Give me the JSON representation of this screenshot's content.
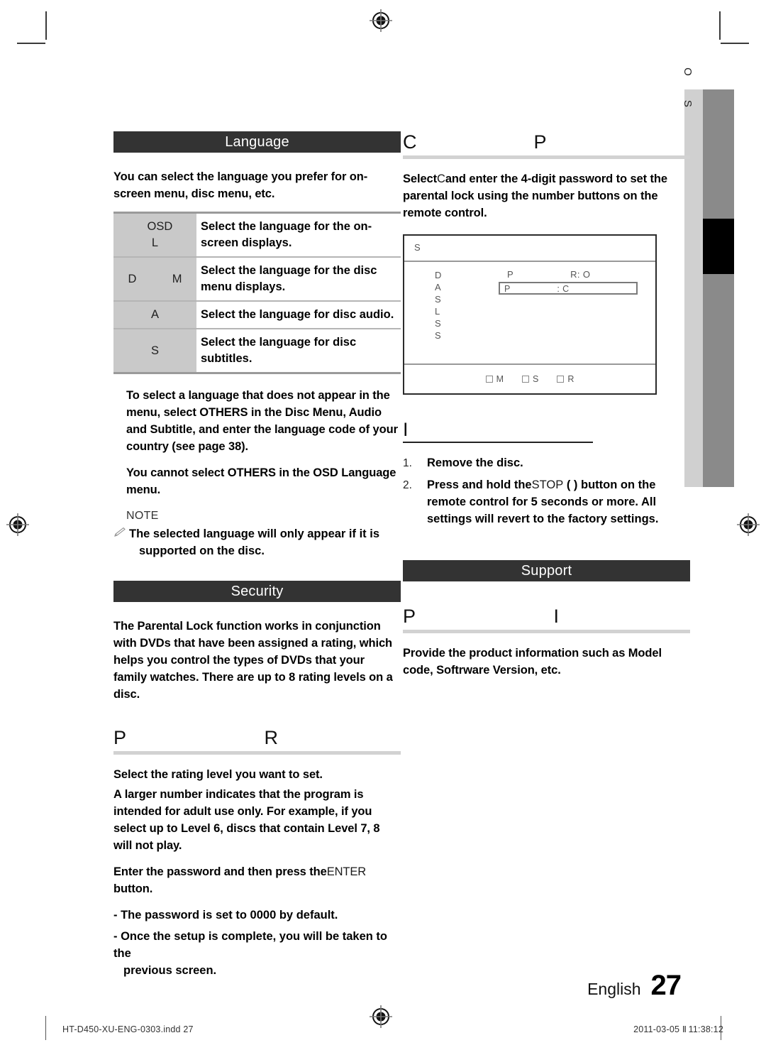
{
  "document": {
    "footer_language": "English",
    "page_number": "27",
    "print_filename": "HT-D450-XU-ENG-0303.indd   27",
    "print_date": "2011-03-05",
    "print_separator": "Ⅱ",
    "print_time": "11:38:12"
  },
  "thumb_tab": {
    "letters": "OS"
  },
  "left_column": {
    "section_header": "Language",
    "intro": "You can select the language you prefer for on-screen menu, disc menu, etc.",
    "table": {
      "rows": [
        {
          "label": "   OSD\nL",
          "description": "Select the language for the on-screen displays."
        },
        {
          "label": "D           M",
          "description": "Select the language for the disc menu displays."
        },
        {
          "label": "A",
          "description": "Select the language for disc audio."
        },
        {
          "label": "S",
          "description": "Select the language for disc subtitles."
        }
      ]
    },
    "paragraph_1": "To select a language that does not appear in the menu, select OTHERS in the Disc Menu, Audio and Subtitle, and enter the language code of your country (see page 38).",
    "paragraph_2": "You cannot select OTHERS in the OSD Language menu.",
    "note_title": "NOTE",
    "note_text": "The selected language will only appear if it is",
    "note_text_cont": "supported on the disc.",
    "security_header": "Security",
    "security_intro": "The Parental Lock function works in conjunction with DVDs that have been assigned a rating, which helps you control the types of DVDs that your family watches. There are up to 8 rating levels on a disc.",
    "parental_rating_subhead": "P                          R",
    "rating_line_1": "Select the rating level you want to set.",
    "rating_line_2": "A larger number indicates that the program is intended for adult use only. For example, if you select up to Level 6, discs that contain Level 7, 8 will not play.",
    "enter_password_pre": "Enter the password and then press the",
    "enter_password_button": "ENTER",
    "enter_password_post": " button.",
    "dash_1_pre": "- The password is set to ",
    "dash_1_value": "0000",
    "dash_1_post": " by default.",
    "dash_2": "- Once the setup is complete, you will be taken to the",
    "dash_2_cont": "previous screen."
  },
  "right_column": {
    "change_password_subhead": "C                      P",
    "change_password_pre": "Select",
    "change_password_ui": "C",
    "change_password_post": "and enter the 4-digit password to set the parental lock using the number buttons on the remote control.",
    "osd": {
      "title": "S",
      "menu_items": [
        "D",
        "A",
        "S",
        "L",
        "S",
        "S"
      ],
      "right_label": "P                    R: O",
      "field_value": "P                 : C",
      "footer_keys": [
        {
          "label": "M"
        },
        {
          "label": "S"
        },
        {
          "label": "R"
        }
      ]
    },
    "forgot_password_subhead": "I",
    "steps": [
      {
        "num": "1.",
        "text": "Remove the disc."
      },
      {
        "num": "2.",
        "text_pre": "Press and hold the",
        "button": "STOP",
        "text_post": " (  ) button on the remote control for 5 seconds or more. All settings will revert to the factory settings."
      }
    ],
    "support_header": "Support",
    "product_info_subhead": "P                          I",
    "support_text": "Provide the product information such as Model code, Softrware Version, etc."
  }
}
